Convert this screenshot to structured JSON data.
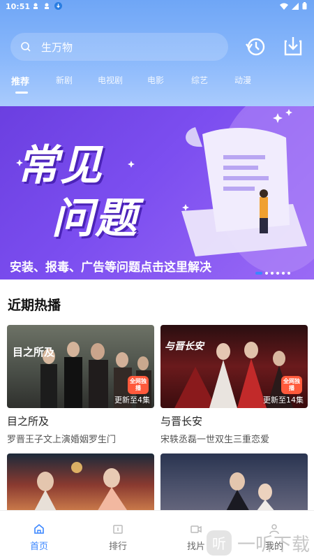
{
  "status": {
    "time": "10:51"
  },
  "search": {
    "placeholder": "生万物"
  },
  "tabs": [
    "推荐",
    "新剧",
    "电视剧",
    "电影",
    "综艺",
    "动漫"
  ],
  "banner": {
    "title_line1": "常见",
    "title_line2": "问题",
    "caption": "安装、报毒、广告等问题点击这里解决"
  },
  "section": {
    "title": "近期热播"
  },
  "cards": [
    {
      "title": "目之所及",
      "subtitle": "罗晋王子文上演婚姻罗生门",
      "episode": "更新至4集",
      "badge": "全网独播",
      "poster_text": "目之所及"
    },
    {
      "title": "与晋长安",
      "subtitle": "宋轶丞磊一世双生三重恋爱",
      "episode": "更新至14集",
      "badge": "全网独播",
      "poster_text": "与晋长安"
    }
  ],
  "bottom_nav": [
    {
      "label": "首页",
      "icon": "home-icon"
    },
    {
      "label": "排行",
      "icon": "rank-icon"
    },
    {
      "label": "找片",
      "icon": "find-movie-icon"
    },
    {
      "label": "我的",
      "icon": "profile-icon"
    }
  ],
  "watermark": "一听下载",
  "colors": {
    "accent": "#3a86ff",
    "header": "#7aaef8",
    "banner": "#7c4ef0"
  }
}
